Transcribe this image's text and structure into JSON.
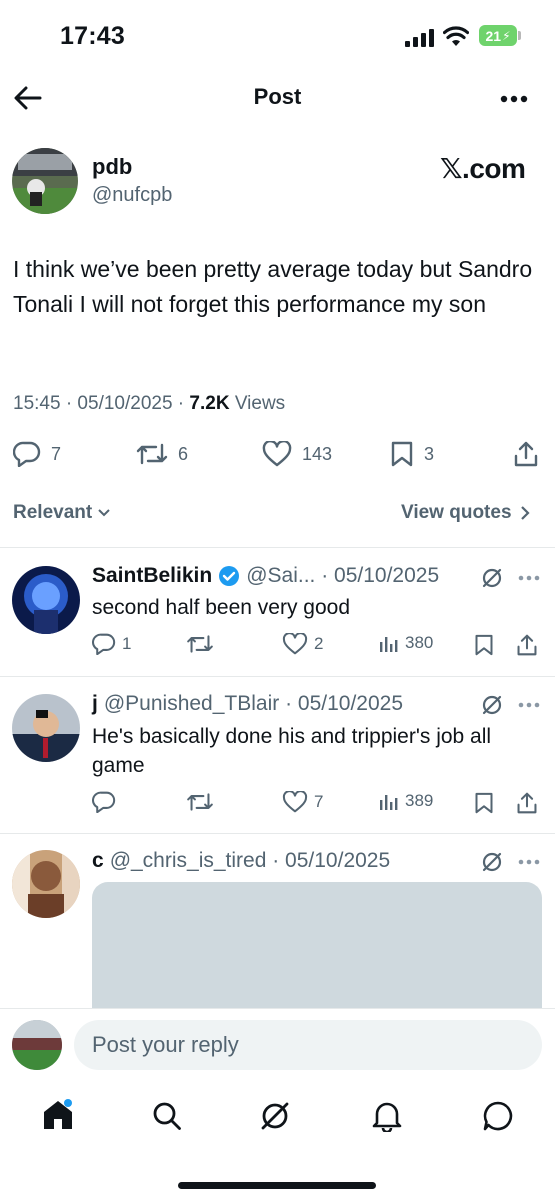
{
  "status_bar": {
    "time": "17:43",
    "battery": "21"
  },
  "header": {
    "title": "Post"
  },
  "post": {
    "author_name": "pdb",
    "author_handle": "@nufcpb",
    "source_badge": "𝕏.com",
    "text": "I think we’ve been pretty average today but Sandro Tonali I will not forget this performance my son",
    "timestamp": "15:45 · 05/10/2025 · ",
    "views_count": "7.2K",
    "views_label": " Views",
    "replies": "7",
    "reposts": "6",
    "likes": "143",
    "bookmarks": "3"
  },
  "filters": {
    "left": "Relevant",
    "right": "View quotes"
  },
  "replies": [
    {
      "name": "SaintBelikin",
      "handle_date": "@Sai... · 05/10/2025",
      "text": "second half been very good",
      "replies": "1",
      "reposts": "",
      "likes": "2",
      "views": "380"
    },
    {
      "name": "j",
      "handle_date": "@Punished_TBlair · 05/10/2025",
      "text": "He's basically done his and trippier's job all game",
      "replies": "",
      "reposts": "",
      "likes": "7",
      "views": "389"
    },
    {
      "name": "c",
      "handle_date": "@_chris_is_tired · 05/10/2025",
      "text": ""
    }
  ],
  "compose": {
    "placeholder": "Post your reply"
  },
  "colors": {
    "text": "#0f1419",
    "secondary": "#536471",
    "verified": "#1d9bf0",
    "battery": "#6fd36c"
  }
}
